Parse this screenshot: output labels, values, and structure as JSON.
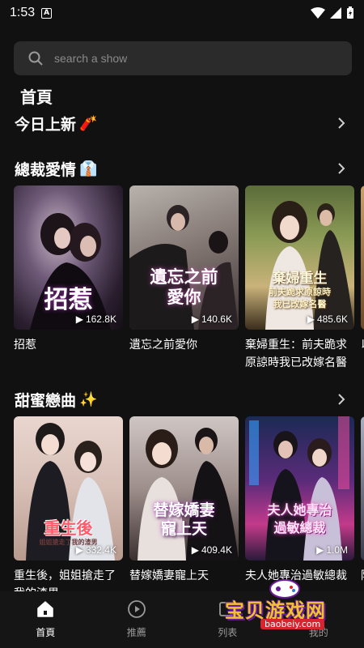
{
  "status": {
    "time": "1:53",
    "notif_letter": "A"
  },
  "search": {
    "placeholder": "search a show"
  },
  "page_title": "首頁",
  "sections": [
    {
      "title": "今日上新",
      "emoji": "🧨"
    },
    {
      "title": "總裁愛情",
      "emoji": "👔",
      "cards": [
        {
          "title": "招惹",
          "views": "162.8K",
          "poster_text": "招惹"
        },
        {
          "title": "遺忘之前愛你",
          "views": "140.6K",
          "poster_text": "遺忘之前\n愛你"
        },
        {
          "title": "棄婦重生：前夫跪求原諒時我已改嫁名醫",
          "views": "485.6K",
          "poster_text": "棄婦重生",
          "poster_sub": "前夫跪求原諒時\n我已改嫁名醫"
        }
      ],
      "peek_title": "以"
    },
    {
      "title": "甜蜜戀曲",
      "emoji": "✨",
      "cards": [
        {
          "title": "重生後，姐姐搶走了我的渣男",
          "views": "332.4K",
          "poster_text": "重生後",
          "poster_sub": "姐姐搶走了我的渣男"
        },
        {
          "title": "替嫁嬌妻寵上天",
          "views": "409.4K",
          "poster_text": "替嫁嬌妻\n寵上天"
        },
        {
          "title": "夫人她專治過敏總裁",
          "views": "1.0M",
          "poster_text": "夫人她專治\n過敏總裁"
        }
      ],
      "peek_title": "陳"
    }
  ],
  "nav": [
    {
      "label": "首頁",
      "icon": "home-icon",
      "active": true
    },
    {
      "label": "推薦",
      "icon": "play-circle-icon",
      "active": false
    },
    {
      "label": "列表",
      "icon": "list-icon",
      "active": false
    },
    {
      "label": "我的",
      "icon": "profile-icon",
      "active": false
    }
  ],
  "watermark": {
    "text": "宝贝游戏网",
    "url": "baobeiy.com"
  },
  "colors": {
    "background": "#111111",
    "search_bg": "#2b2b2b",
    "accent_watermark": "#f2c12e"
  }
}
